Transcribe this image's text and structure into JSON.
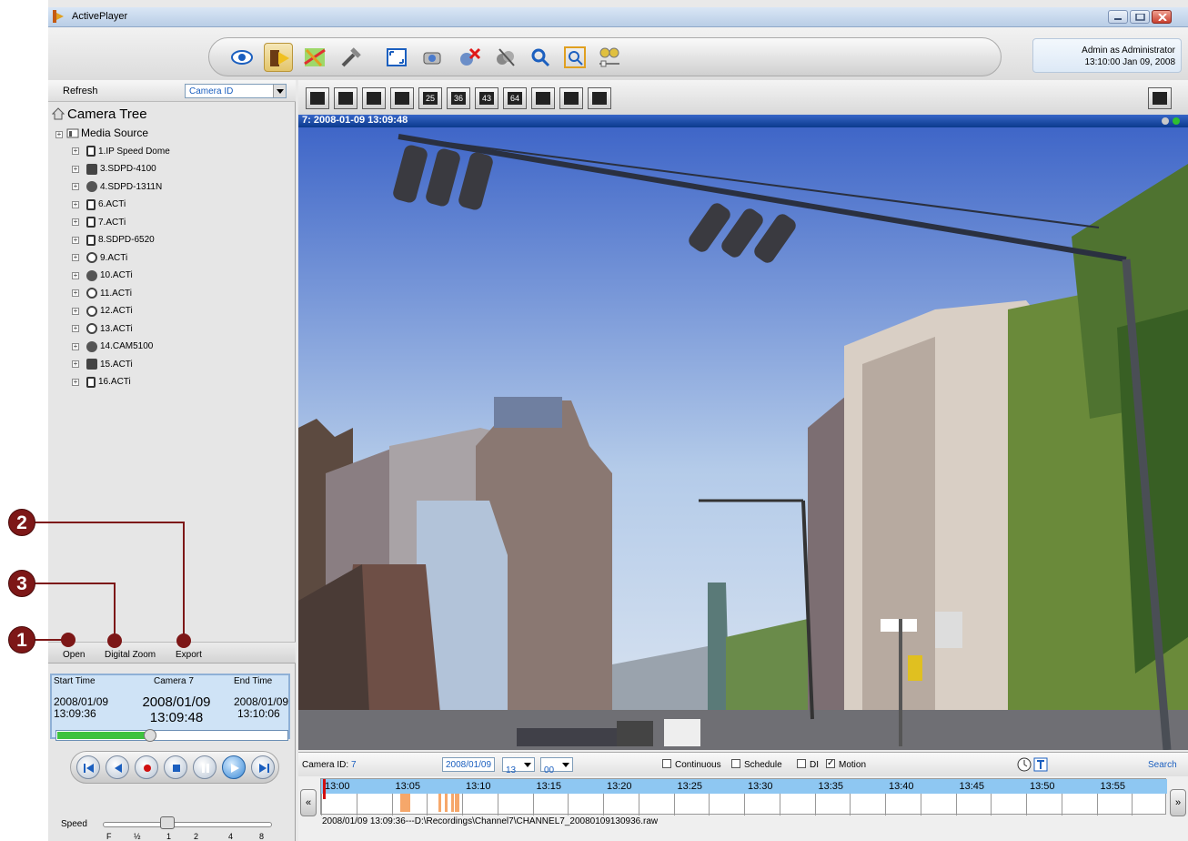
{
  "app": {
    "title": "ActivePlayer"
  },
  "user": {
    "line1": "Admin as Administrator",
    "line2": "13:10:00 Jan 09, 2008"
  },
  "left": {
    "refresh_label": "Refresh",
    "camera_select": "Camera ID",
    "tree_root": "Camera Tree",
    "media_source": "Media Source",
    "items": [
      "1.IP Speed Dome",
      "3.SDPD-4100",
      "4.SDPD-1311N",
      "6.ACTi",
      "7.ACTi",
      "8.SDPD-6520",
      "9.ACTi",
      "10.ACTi",
      "11.ACTi",
      "12.ACTi",
      "13.ACTi",
      "14.CAM5100",
      "15.ACTi",
      "16.ACTi"
    ],
    "tools": {
      "open": "Open",
      "digital_zoom": "Digital Zoom",
      "export": "Export"
    },
    "info": {
      "start_hdr": "Start Time",
      "cam_hdr": "Camera 7",
      "end_hdr": "End Time",
      "start_date": "2008/01/09",
      "start_time": "13:09:36",
      "cur_date": "2008/01/09",
      "cur_time": "13:09:48",
      "end_date": "2008/01/09",
      "end_time": "13:10:06",
      "progress": 0.4
    },
    "speed": {
      "label": "Speed",
      "ticks": [
        "F",
        "½",
        "1",
        "2",
        "4",
        "8"
      ]
    }
  },
  "layout_buttons": [
    "",
    "",
    "",
    "",
    "25",
    "36",
    "43",
    "64",
    "",
    "",
    ""
  ],
  "video": {
    "header": "7:   2008-01-09 13:09:48"
  },
  "search": {
    "camera_id_label": "Camera ID:",
    "camera_id": "7",
    "date": "2008/01/09",
    "hour": "13",
    "minute": "00",
    "continuous": "Continuous",
    "schedule": "Schedule",
    "di": "DI",
    "motion": "Motion",
    "search_label": "Search"
  },
  "timeline": {
    "ticks": [
      "13:00",
      "13:05",
      "13:10",
      "13:15",
      "13:20",
      "13:25",
      "13:30",
      "13:35",
      "13:40",
      "13:45",
      "13:50",
      "13:55"
    ]
  },
  "filepath": "2008/01/09 13:09:36---D:\\Recordings\\Channel7\\CHANNEL7_20080109130936.raw",
  "annotations": {
    "n1": "1",
    "n2": "2",
    "n3": "3"
  },
  "colors": {
    "accent": "#0b3a8d",
    "annotation": "#7d1717",
    "progress": "#3ec23e",
    "recording": "#f6a76a"
  }
}
